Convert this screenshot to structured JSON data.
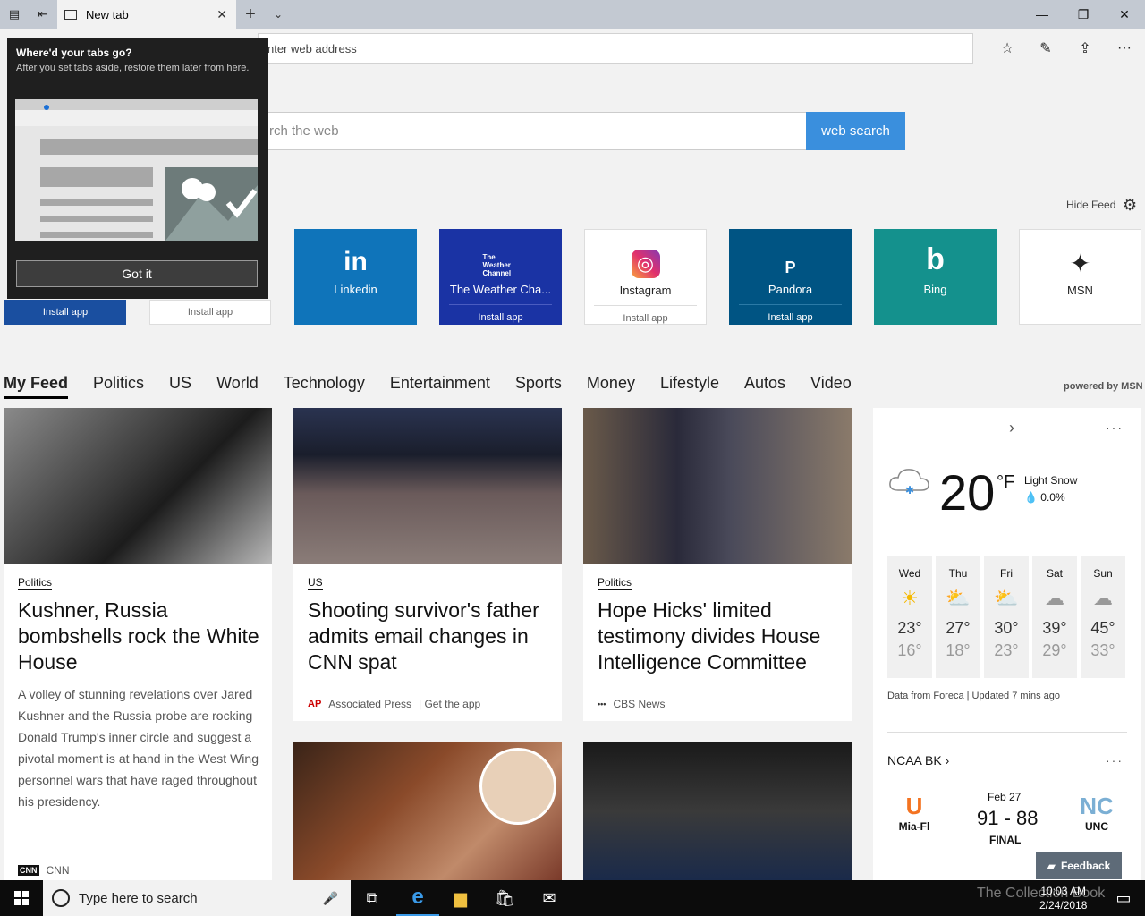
{
  "tabbar": {
    "tab_title": "New tab",
    "new_tab": "+",
    "close": "✕",
    "dropdown": "⌄",
    "minimize": "—",
    "maximize": "❐",
    "close_window": "✕"
  },
  "address": {
    "placeholder": "nter web address"
  },
  "toolbar": {
    "favorites": "☆",
    "notes": "✎",
    "share": "⇪",
    "more": "···"
  },
  "search": {
    "placeholder": "rch the web",
    "button": "web search"
  },
  "feed_controls": {
    "hide_feed": "Hide Feed",
    "gear": "⚙"
  },
  "popup": {
    "title": "Where'd your tabs go?",
    "text": "After you set tabs aside, restore them later from here.",
    "button": "Got it"
  },
  "tiles": [
    {
      "name": "Linkedin",
      "logo": "in",
      "install": "",
      "bg": "#0f74ba"
    },
    {
      "name": "The Weather Cha...",
      "logo": "The Weather Channel",
      "install": "Install app",
      "bg": "#1a33a4"
    },
    {
      "name": "Instagram",
      "logo": "◎",
      "install": "Install app",
      "bg": "#ffffff"
    },
    {
      "name": "Pandora",
      "logo": "P",
      "install": "Install app",
      "bg": "#005483"
    },
    {
      "name": "Bing",
      "logo": "b",
      "install": "",
      "bg": "#14918d"
    },
    {
      "name": "MSN",
      "logo": "✦",
      "install": "",
      "bg": "#ffffff"
    }
  ],
  "partial_tiles": {
    "first_install": "Install app",
    "second_install": "Install app"
  },
  "feednav": {
    "items": [
      "My Feed",
      "Politics",
      "US",
      "World",
      "Technology",
      "Entertainment",
      "Sports",
      "Money",
      "Lifestyle",
      "Autos",
      "Video"
    ],
    "powered": "powered by MSN"
  },
  "cards": [
    {
      "category": "Politics",
      "headline": "Kushner, Russia bombshells rock the White House",
      "summary": "A volley of stunning revelations over Jared Kushner and the Russia probe are rocking Donald Trump's inner circle and suggest a pivotal moment is at hand in the West Wing personnel wars that have raged throughout his presidency.",
      "source": "CNN",
      "source_logo": "CNN"
    },
    {
      "category": "US",
      "headline": "Shooting survivor's father admits email changes in CNN spat",
      "source": "Associated Press",
      "source_extra": "| Get the app",
      "source_logo": "AP"
    },
    {
      "category": "Politics",
      "headline": "Hope Hicks' limited testimony divides House Intelligence Committee",
      "source": "CBS News",
      "source_logo": "•••"
    }
  ],
  "weather": {
    "next": "›",
    "more": "···",
    "temp": "20",
    "unit": "°F",
    "condition": "Light Snow",
    "precip": "0.0%",
    "days": [
      {
        "name": "Wed",
        "icon": "☀",
        "hi": "23°",
        "lo": "16°"
      },
      {
        "name": "Thu",
        "icon": "⛅",
        "hi": "27°",
        "lo": "18°"
      },
      {
        "name": "Fri",
        "icon": "⛅",
        "hi": "30°",
        "lo": "23°"
      },
      {
        "name": "Sat",
        "icon": "☁",
        "hi": "39°",
        "lo": "29°"
      },
      {
        "name": "Sun",
        "icon": "☁",
        "hi": "45°",
        "lo": "33°"
      }
    ],
    "data_source": "Data from Foreca | Updated 7 mins ago"
  },
  "ncaa": {
    "title": "NCAA BK ›",
    "more": "···",
    "date": "Feb 27",
    "score": "91 - 88",
    "status": "FINAL",
    "team1": "Mia-Fl",
    "team2": "UNC",
    "team1_color": "#f47321",
    "team2_color": "#7bafd4"
  },
  "feedback": {
    "label": "Feedback"
  },
  "taskbar": {
    "search_placeholder": "Type here to search",
    "time": "10:03 AM",
    "date": "2/24/2018",
    "watermark": "The Collection Book"
  }
}
